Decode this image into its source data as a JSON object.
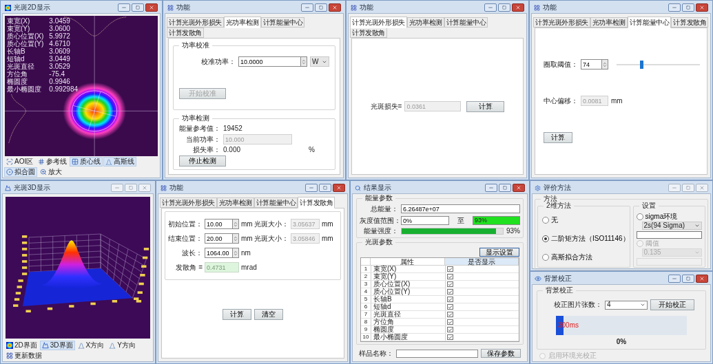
{
  "beam_2d": {
    "title": "光斑2D显示",
    "active": true,
    "params": [
      {
        "label": "束宽(X)",
        "value": "3.0459"
      },
      {
        "label": "束宽(Y)",
        "value": "3.0600"
      },
      {
        "label": "质心位置(X)",
        "value": "5.9972"
      },
      {
        "label": "质心位置(Y)",
        "value": "4.6710"
      },
      {
        "label": "长轴B",
        "value": "3.0609"
      },
      {
        "label": "短轴d",
        "value": "3.0449"
      },
      {
        "label": "光斑直径",
        "value": "3.0529"
      },
      {
        "label": "方位角",
        "value": "-75.4"
      },
      {
        "label": "椭圆度",
        "value": "0.9946"
      },
      {
        "label": "最小椭圆度",
        "value": "0.992984"
      }
    ],
    "toolbar": [
      {
        "label": "AOI区",
        "selected": false
      },
      {
        "label": "参考线",
        "selected": false
      },
      {
        "label": "质心线",
        "selected": true
      },
      {
        "label": "高斯线",
        "selected": true
      },
      {
        "label": "拟合圆",
        "selected": true
      },
      {
        "label": "放大",
        "selected": false
      }
    ]
  },
  "function_windows": [
    {
      "kind": "power",
      "title": "功能",
      "active": true,
      "tabs": [
        {
          "label": "计算光斑外形损失",
          "selected": false
        },
        {
          "label": "光功率检测",
          "selected": true
        },
        {
          "label": "计算能量中心",
          "selected": false
        },
        {
          "label": "计算发散角",
          "selected": false
        }
      ],
      "calibration": {
        "title": "功率校准",
        "label": "校准功率：",
        "field": {
          "value": "10.0000",
          "disabled": false
        },
        "unit": "W",
        "button": {
          "label": "开始校准",
          "disabled": true
        }
      },
      "detection": {
        "title": "功率检测",
        "reference_label": "能量参考值：",
        "reference_value": "19452",
        "power_label": "当前功率：",
        "power_field": {
          "value": "10.000",
          "disabled": true
        },
        "loss_label": "损失率：",
        "loss_value": "0.000",
        "loss_unit": "%",
        "button": {
          "label": "停止检测",
          "disabled": false
        }
      }
    },
    {
      "kind": "shape_loss",
      "title": "功能",
      "active": true,
      "tabs": [
        {
          "label": "计算光斑外形损失",
          "selected": true
        },
        {
          "label": "光功率检测",
          "selected": false
        },
        {
          "label": "计算能量中心",
          "selected": false
        },
        {
          "label": "计算发散角",
          "selected": false
        }
      ],
      "label": "光斑损失=",
      "field": {
        "value": "0.0361",
        "disabled": true
      },
      "button": "计算"
    },
    {
      "kind": "center",
      "title": "功能",
      "active": true,
      "tabs": [
        {
          "label": "计算光斑外形损失",
          "selected": false
        },
        {
          "label": "光功率检测",
          "selected": false
        },
        {
          "label": "计算能量中心",
          "selected": true
        },
        {
          "label": "计算发散角",
          "selected": false
        }
      ],
      "threshold_label": "圈取阈值：",
      "threshold_field": {
        "value": "74",
        "disabled": false
      },
      "slider": {
        "level": 0.3
      },
      "offset_label": "中心偏移：",
      "offset_field": {
        "value": "0.0081",
        "disabled": true
      },
      "offset_unit": "mm",
      "button": "计算"
    },
    {
      "kind": "divergence",
      "title": "功能",
      "active": true,
      "tabs": [
        {
          "label": "计算光斑外形损失",
          "selected": false
        },
        {
          "label": "光功率检测",
          "selected": false
        },
        {
          "label": "计算能量中心",
          "selected": false
        },
        {
          "label": "计算发散角",
          "selected": true
        }
      ],
      "rows": [
        {
          "label": "初始位置：",
          "field": {
            "value": "10.00",
            "disabled": false
          },
          "unit": "mm",
          "size_label": "光斑大小：",
          "size_field": {
            "value": "3.05637",
            "disabled": true
          },
          "size_unit": "mm"
        },
        {
          "label": "结束位置：",
          "field": {
            "value": "20.00",
            "disabled": false
          },
          "unit": "mm",
          "size_label": "光斑大小：",
          "size_field": {
            "value": "3.05846",
            "disabled": true
          },
          "size_unit": "mm"
        },
        {
          "label": "波长：",
          "field": {
            "value": "1064.00",
            "disabled": false
          },
          "unit": "nm"
        }
      ],
      "result": {
        "label": "发散角 =",
        "value": "0.4731",
        "unit": "mrad"
      },
      "buttons": [
        "计算",
        "清空"
      ]
    }
  ],
  "beam_3d": {
    "title": "光斑3D显示",
    "active": false,
    "toolbar": [
      {
        "label": "2D界面",
        "selected": false
      },
      {
        "label": "3D界面",
        "selected": true
      },
      {
        "label": "X方向",
        "selected": false
      },
      {
        "label": "Y方向",
        "selected": false
      },
      {
        "label": "更新数据",
        "selected": false
      }
    ]
  },
  "results": {
    "title": "结果显示",
    "active": true,
    "energy": {
      "title": "能量参数",
      "total_label": "总能量：",
      "total_value": "6.26487e+07",
      "range_label": "灰度值范围：",
      "range_from": "0%",
      "range_to_label": "至",
      "range_to": "93%",
      "intensity_label": "能量强度：",
      "intensity": {
        "level": 0.93
      },
      "intensity_reading": "93%"
    },
    "spot": {
      "title": "光斑参数",
      "button": "显示设置",
      "columns": [
        "属性",
        "是否显示"
      ],
      "rows": [
        {
          "index": "1",
          "name": "束宽(X)",
          "checked": true
        },
        {
          "index": "2",
          "name": "束宽(Y)",
          "checked": true
        },
        {
          "index": "3",
          "name": "质心位置(X)",
          "checked": true
        },
        {
          "index": "4",
          "name": "质心位置(Y)",
          "checked": true
        },
        {
          "index": "5",
          "name": "长轴B",
          "checked": true
        },
        {
          "index": "6",
          "name": "短轴d",
          "checked": true
        },
        {
          "index": "7",
          "name": "光斑直径",
          "checked": true
        },
        {
          "index": "8",
          "name": "方位角",
          "checked": true
        },
        {
          "index": "9",
          "name": "椭圆度",
          "checked": true
        },
        {
          "index": "10",
          "name": "最小椭圆度",
          "checked": true
        }
      ]
    },
    "sample_label": "样品名称：",
    "save_button": "保存参数"
  },
  "evaluation": {
    "title": "评价方法",
    "active": false,
    "group": "方法",
    "methods": {
      "title": "2维方法",
      "options": [
        {
          "label": "无",
          "selected": false
        },
        {
          "label": "二阶矩方法（ISO11146）",
          "selected": true
        },
        {
          "label": "高斯拟合方法",
          "selected": false
        }
      ]
    },
    "settings": {
      "title": "设置",
      "options": [
        {
          "label": "sigma环境",
          "selected": false,
          "disabled": false,
          "dropdown": "2s(94 Sigma)"
        },
        {
          "label": "阈值",
          "selected": false,
          "disabled": true,
          "dropdown": "0.135"
        }
      ]
    }
  },
  "background": {
    "title": "背景校正",
    "active": true,
    "group": "背景校正",
    "count_label": "校正图片张数：",
    "count_value": "4",
    "button": "开始校正",
    "progress": {
      "level": 0.06,
      "reading": "300ms"
    },
    "percent": "0%",
    "ambient": {
      "label": "启用环境光校正",
      "checked": false,
      "disabled": true
    }
  }
}
